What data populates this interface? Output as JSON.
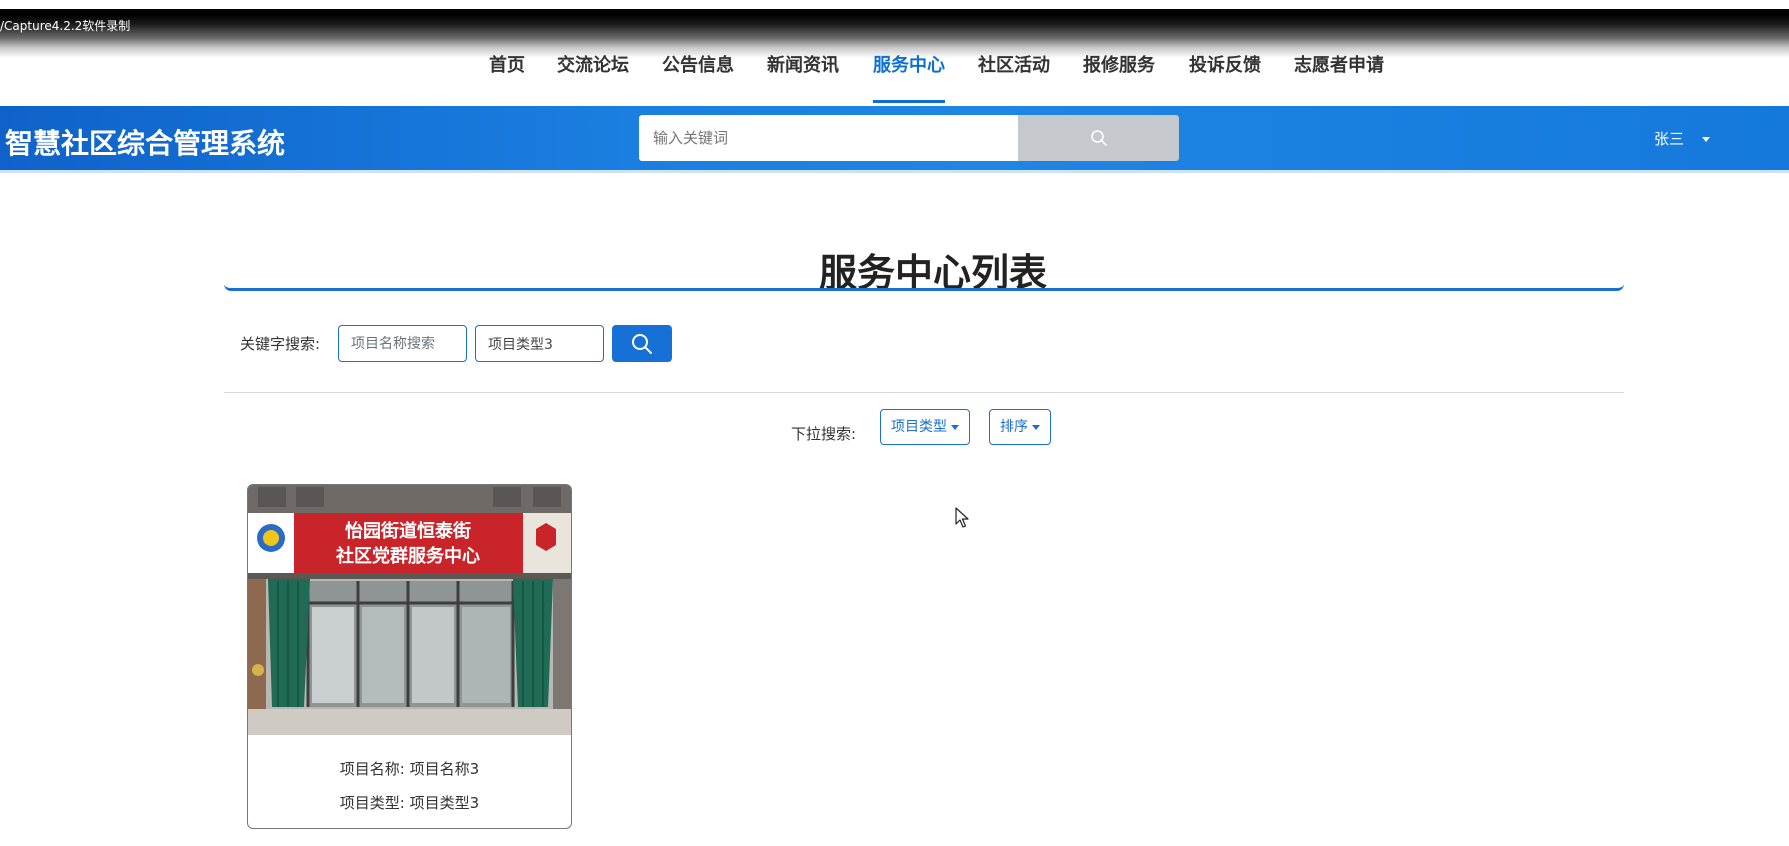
{
  "recorder_label": "/Capture4.2.2软件录制",
  "nav": {
    "items": [
      {
        "label": "首页"
      },
      {
        "label": "交流论坛"
      },
      {
        "label": "公告信息"
      },
      {
        "label": "新闻资讯"
      },
      {
        "label": "服务中心",
        "active": true
      },
      {
        "label": "社区活动"
      },
      {
        "label": "报修服务"
      },
      {
        "label": "投诉反馈"
      },
      {
        "label": "志愿者申请"
      }
    ],
    "active_color": "#0d6fd3"
  },
  "header": {
    "site_title": "智慧社区综合管理系统",
    "search_placeholder": "输入关键词",
    "search_icon": "search-icon",
    "user_name": "张三"
  },
  "main": {
    "page_title": "服务中心列表",
    "keyword_search": {
      "label": "关键字搜索:",
      "name_placeholder": "项目名称搜索",
      "type_value": "项目类型3",
      "button_icon": "search-icon"
    },
    "dropdown_search": {
      "label": "下拉搜索:",
      "type_button": "项目类型",
      "sort_button": "排序"
    },
    "cards": [
      {
        "sign_line1": "怡园街道恒泰街",
        "sign_line2": "社区党群服务中心",
        "name_label": "项目名称:",
        "name_value": "项目名称3",
        "type_label": "项目类型:",
        "type_value": "项目类型3"
      }
    ]
  },
  "colors": {
    "brand_blue": "#1670d6",
    "banner_blue": "#1a7fe0",
    "search_btn_gray": "#c5c8cc"
  }
}
